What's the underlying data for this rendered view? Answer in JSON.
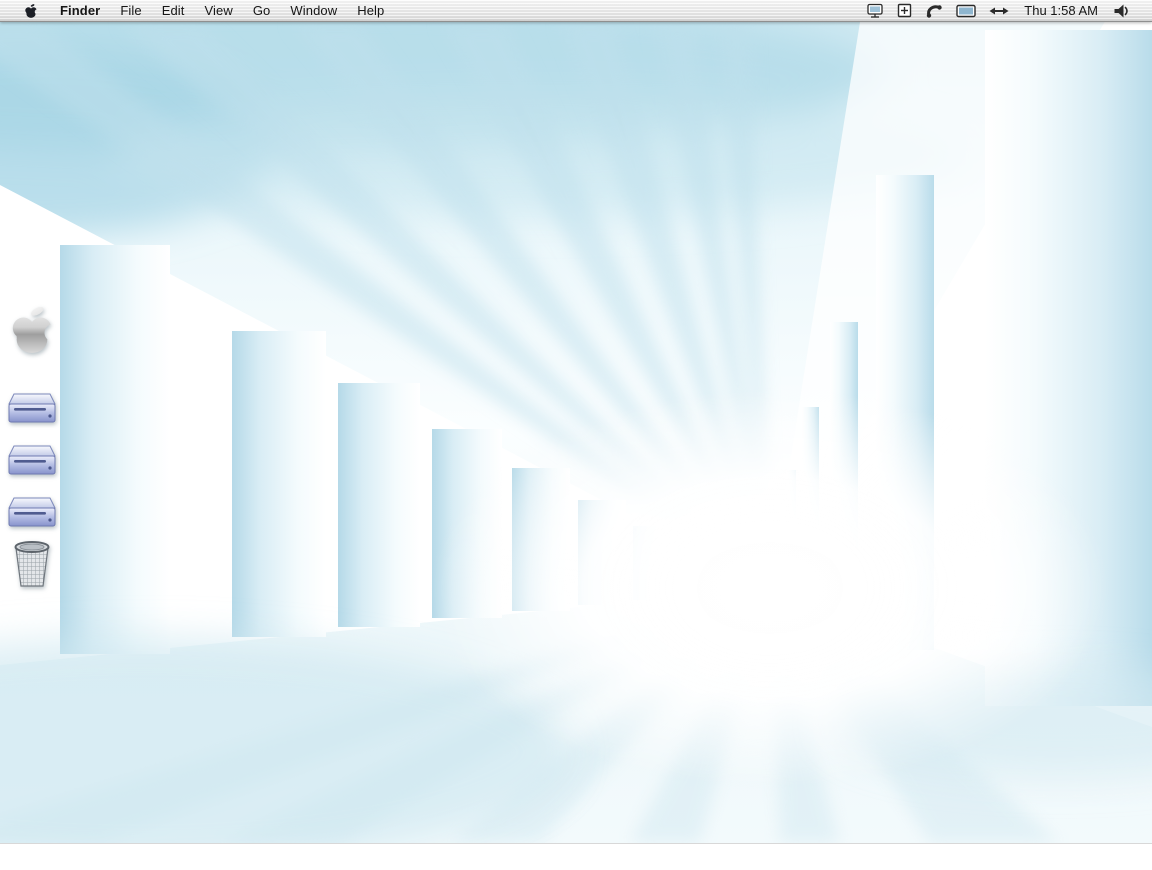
{
  "menu_bar": {
    "menus": [
      {
        "label": "Finder"
      },
      {
        "label": "File"
      },
      {
        "label": "Edit"
      },
      {
        "label": "View"
      },
      {
        "label": "Go"
      },
      {
        "label": "Window"
      },
      {
        "label": "Help"
      }
    ],
    "clock": "Thu 1:58 AM",
    "extras": [
      {
        "name": "display"
      },
      {
        "name": "plus-box"
      },
      {
        "name": "phone"
      },
      {
        "name": "monitor"
      },
      {
        "name": "network-arrows"
      },
      {
        "name": "volume"
      }
    ]
  },
  "desktop": {
    "wallpaper": {
      "description": "White and pale-blue colonnade corridor receding to a bright vanishing point",
      "base_color": "#eaf6fa",
      "shadow_color": "#b5d9e8"
    },
    "icons": [
      {
        "name": "apple-logo"
      },
      {
        "name": "hard-disk-1"
      },
      {
        "name": "hard-disk-2"
      },
      {
        "name": "hard-disk-3"
      },
      {
        "name": "trash"
      }
    ]
  }
}
